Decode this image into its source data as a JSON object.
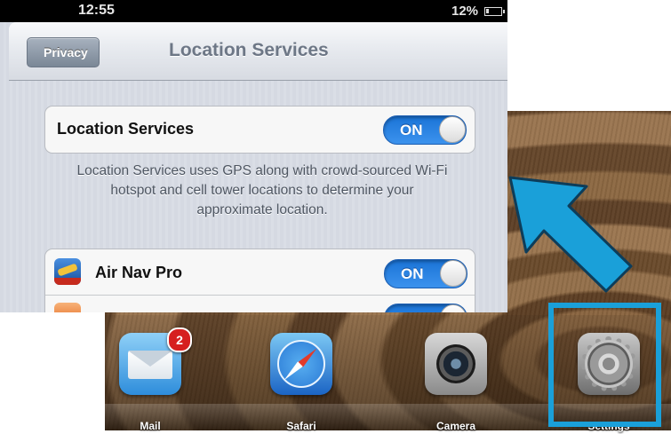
{
  "status_bar": {
    "time": "12:55",
    "battery": "12%"
  },
  "nav": {
    "back_label": "Privacy",
    "title": "Location Services"
  },
  "location_services": {
    "label": "Location Services",
    "toggle": "ON"
  },
  "description": "Location Services uses GPS along with crowd-sourced Wi-Fi hotspot and cell tower locations to determine your approximate location.",
  "apps": [
    {
      "name": "Air Nav Pro",
      "toggle": "ON",
      "icon": "air-nav-pro-icon"
    },
    {
      "name": "",
      "toggle": "",
      "icon": "orange-app-icon"
    }
  ],
  "dock": {
    "items": [
      {
        "label": "Mail",
        "icon": "mail-icon",
        "badge": "2"
      },
      {
        "label": "Safari",
        "icon": "safari-icon"
      },
      {
        "label": "Camera",
        "icon": "camera-icon"
      },
      {
        "label": "Settings",
        "icon": "settings-icon"
      }
    ]
  },
  "colors": {
    "toggle_on": "#2a84e6",
    "highlight": "#1aa0d9",
    "arrow": "#1aa0d9"
  }
}
